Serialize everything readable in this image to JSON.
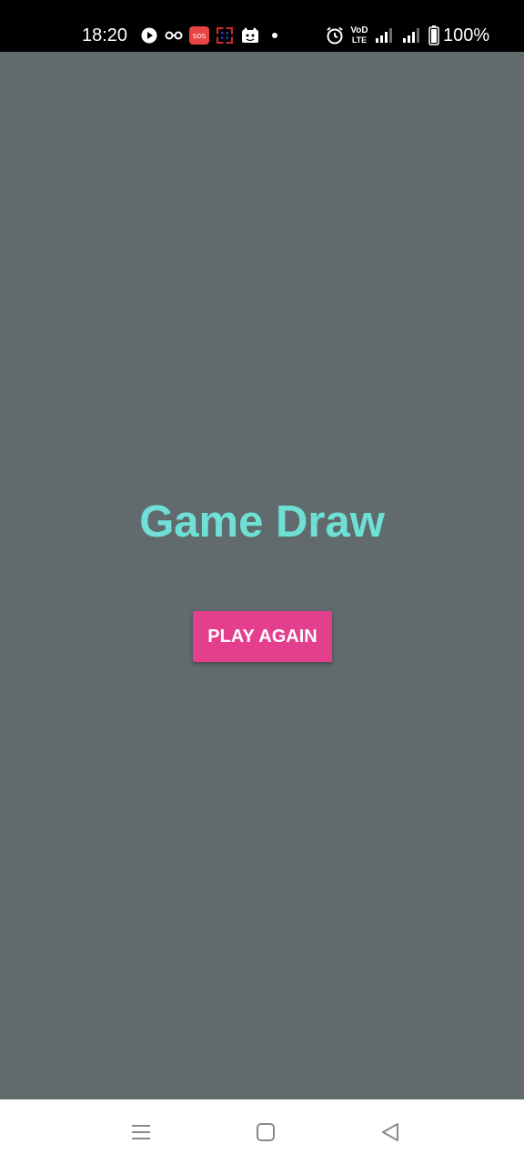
{
  "status_bar": {
    "time": "18:20",
    "battery_percent": "100%",
    "notification_icons": [
      "play-icon",
      "glasses-icon",
      "sos-icon",
      "calendar-icon",
      "cat-icon",
      "dot-icon"
    ],
    "system_icons": [
      "alarm-icon",
      "volte-icon",
      "signal-icon",
      "signal-icon",
      "battery-icon"
    ],
    "sos_label": "SOS",
    "volte_label_top": "VoD",
    "volte_label_bottom": "LTE"
  },
  "main": {
    "background_color": "#616b6e",
    "title": "Game Draw",
    "title_color": "#6ee0d6",
    "play_again_label": "PLAY AGAIN",
    "play_again_color": "#e43f8d"
  },
  "nav_bar": {
    "buttons": [
      "menu-icon",
      "home-icon",
      "back-icon"
    ]
  }
}
